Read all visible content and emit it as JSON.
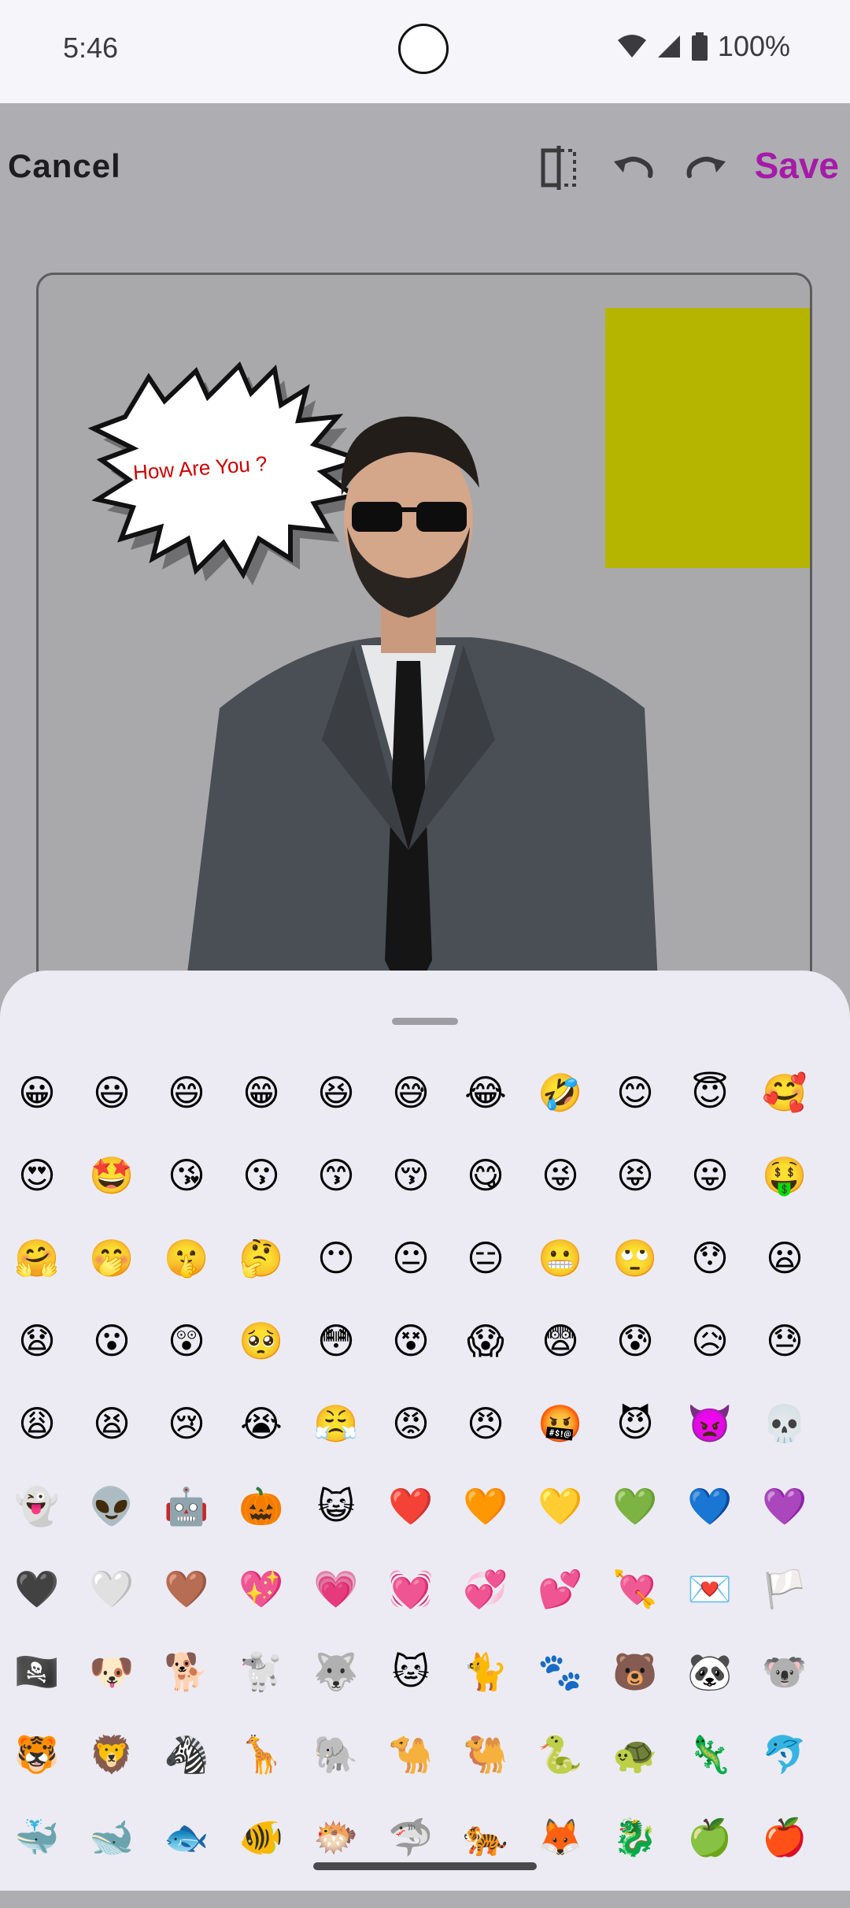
{
  "status": {
    "time": "5:46",
    "battery": "100%"
  },
  "toolbar": {
    "cancel_label": "Cancel",
    "save_label": "Save"
  },
  "icons": {
    "compare": "compare-icon",
    "undo": "undo-icon",
    "redo": "redo-icon"
  },
  "colors": {
    "accent": "#a51aa8",
    "sheet": "#ecebf3",
    "highlight": "#b5b500",
    "bubble_text": "#cc0000"
  },
  "canvas": {
    "bubble_text": "How Are You ?"
  },
  "emojis": [
    [
      "😀",
      "😃",
      "😄",
      "😁",
      "😆",
      "😅",
      "😂",
      "🤣",
      "😊",
      "😇",
      "🥰"
    ],
    [
      "😍",
      "🤩",
      "😘",
      "😗",
      "😙",
      "😚",
      "😋",
      "😜",
      "😝",
      "😛",
      "🤑"
    ],
    [
      "🤗",
      "🤭",
      "🤫",
      "🤔",
      "😶",
      "😐",
      "😑",
      "😬",
      "🙄",
      "😯",
      "😦"
    ],
    [
      "😧",
      "😮",
      "😲",
      "🥺",
      "😳",
      "😵",
      "😱",
      "😨",
      "😰",
      "😥",
      "😓"
    ],
    [
      "😩",
      "😫",
      "😢",
      "😭",
      "😤",
      "😡",
      "😠",
      "🤬",
      "😈",
      "👿",
      "💀"
    ],
    [
      "👻",
      "👽",
      "🤖",
      "🎃",
      "😺",
      "❤️",
      "🧡",
      "💛",
      "💚",
      "💙",
      "💜"
    ],
    [
      "🖤",
      "🤍",
      "🤎",
      "💖",
      "💗",
      "💓",
      "💞",
      "💕",
      "💘",
      "💌",
      "🏳️"
    ],
    [
      "🏴‍☠️",
      "🐶",
      "🐕",
      "🐩",
      "🐺",
      "🐱",
      "🐈",
      "🐾",
      "🐻",
      "🐼",
      "🐨"
    ],
    [
      "🐯",
      "🦁",
      "🦓",
      "🦒",
      "🐘",
      "🐪",
      "🐫",
      "🐍",
      "🐢",
      "🦎",
      "🐬"
    ],
    [
      "🐳",
      "🐋",
      "🐟",
      "🐠",
      "🐡",
      "🦈",
      "🐅",
      "🦊",
      "🐉",
      "🍏",
      "🍎"
    ]
  ]
}
